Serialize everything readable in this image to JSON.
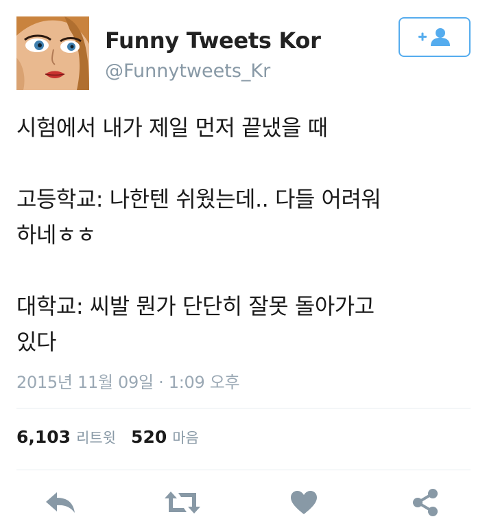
{
  "user": {
    "display_name": "Funny Tweets Kor",
    "handle": "@Funnytweets_Kr"
  },
  "tweet": {
    "lines": [
      "시험에서 내가 제일 먼저 끝냈을 때",
      "",
      "고등학교: 나한텐 쉬웠는데.. 다들 어려워",
      "하네ㅎㅎ",
      "",
      "대학교: 씨발 뭔가 단단히 잘못 돌아가고",
      "있다"
    ],
    "timestamp": "2015년 11월 09일 · 1:09 오후"
  },
  "stats": {
    "retweets_count": "6,103",
    "retweets_label": "리트윗",
    "likes_count": "520",
    "likes_label": "마음"
  },
  "actions": [
    "reply-icon",
    "retweet-icon",
    "heart-icon",
    "share-icon"
  ],
  "colors": {
    "accent": "#55acee",
    "muted": "#8899a6",
    "icon": "#8899a6",
    "divider": "#e6ecf0"
  }
}
